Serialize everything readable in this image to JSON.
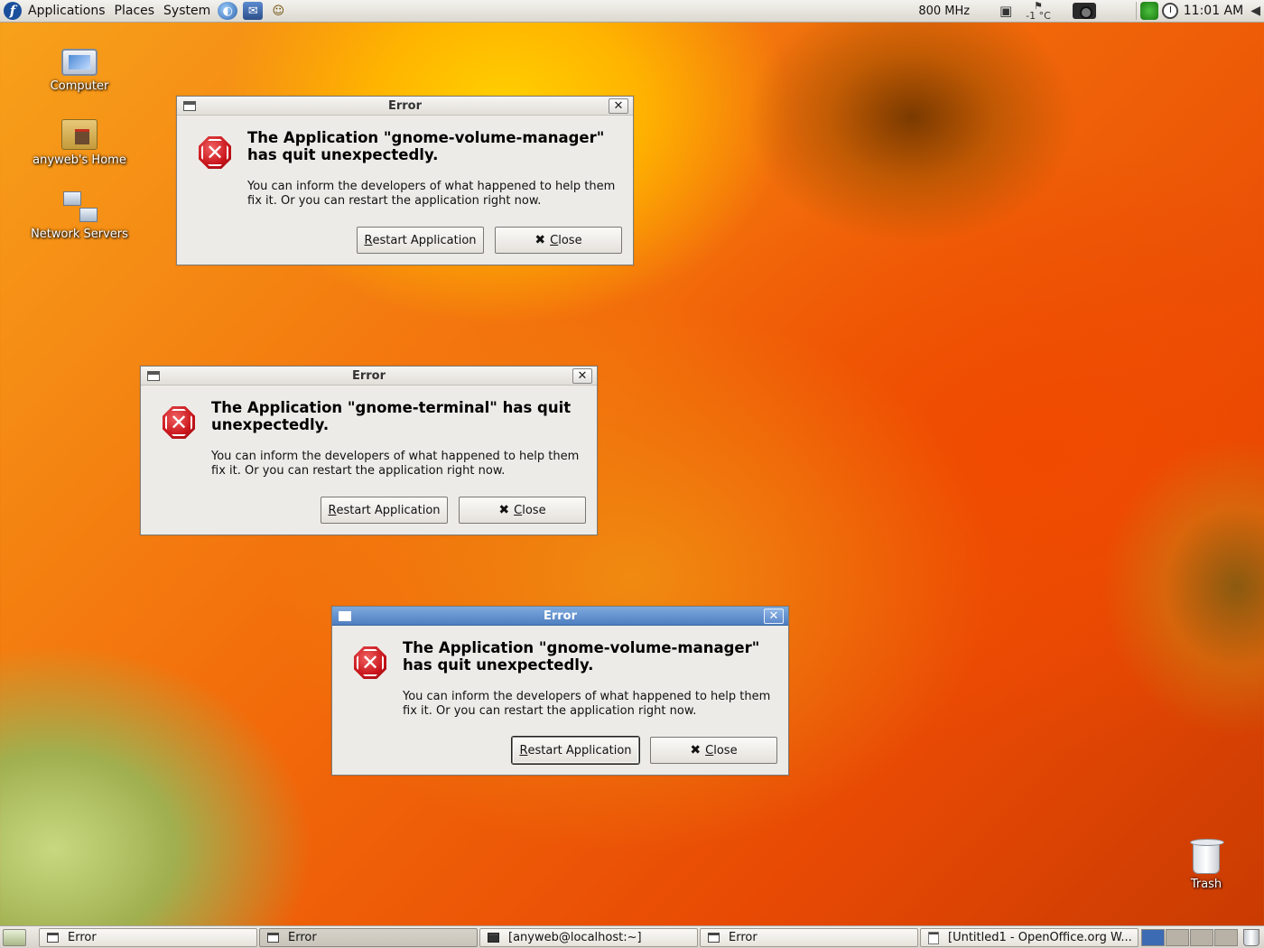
{
  "top_panel": {
    "menus": [
      "Applications",
      "Places",
      "System"
    ],
    "launchers": [
      "web-browser-icon",
      "mail-icon",
      "people-icon"
    ],
    "cpu_freq": "800 MHz",
    "weather": "-1 °C",
    "clock": "11:01 AM"
  },
  "desktop_icons": {
    "computer": "Computer",
    "home": "anyweb's Home",
    "network": "Network Servers",
    "trash": "Trash"
  },
  "dialogs": [
    {
      "title": "Error",
      "headline": "The Application \"gnome-volume-manager\" has quit unexpectedly.",
      "body": "You can inform the developers of what happened to help them\nfix it.  Or you can restart the application right now.",
      "restart_label": "estart Application",
      "restart_mnemonic": "R",
      "close_label": "lose",
      "close_mnemonic": "C"
    },
    {
      "title": "Error",
      "headline": "The Application \"gnome-terminal\" has quit unexpectedly.",
      "body": "You can inform the developers of what happened to help them\nfix it.  Or you can restart the application right now.",
      "restart_label": "estart Application",
      "restart_mnemonic": "R",
      "close_label": "lose",
      "close_mnemonic": "C"
    },
    {
      "title": "Error",
      "headline": "The Application \"gnome-volume-manager\" has quit unexpectedly.",
      "body": "You can inform the developers of what happened to help them\nfix it.  Or you can restart the application right now.",
      "restart_label": "estart Application",
      "restart_mnemonic": "R",
      "close_label": "lose",
      "close_mnemonic": "C"
    }
  ],
  "taskbar": {
    "tasks": [
      "Error",
      "Error",
      "[anyweb@localhost:~]",
      "Error",
      "[Untitled1 - OpenOffice.org W..."
    ]
  },
  "colors": {
    "active_titlebar": "#4f7fc0",
    "dialog_bg": "#edebe7",
    "error_red": "#c8141a"
  }
}
